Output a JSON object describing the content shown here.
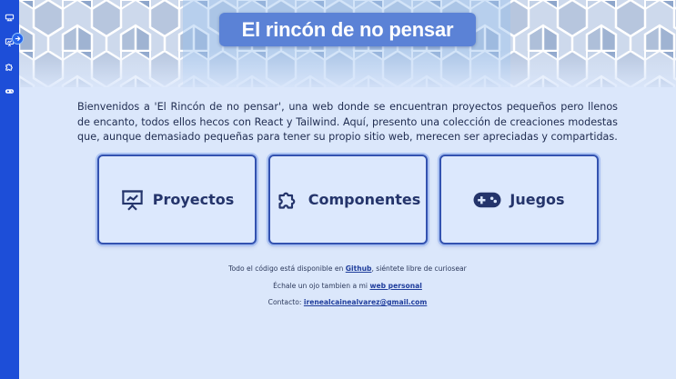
{
  "sidebar": {
    "items": [
      {
        "icon": "gamepad-retro-icon"
      },
      {
        "icon": "presentation-icon"
      },
      {
        "icon": "puzzle-icon"
      },
      {
        "icon": "gamepad-icon"
      }
    ],
    "toggle_icon": "arrow-right-icon"
  },
  "banner": {
    "title": "El rincón de no pensar"
  },
  "intro": {
    "text": "Bienvenidos a 'El Rincón de no pensar', una web donde se encuentran proyectos pequeños pero llenos de encanto, todos ellos hecos con React y Tailwind. Aquí, presento una colección de creaciones modestas que, aunque demasiado pequeñas para tener su propio sitio web, merecen ser apreciadas y compartidas."
  },
  "cards": [
    {
      "label": "Proyectos",
      "icon": "presentation-icon"
    },
    {
      "label": "Componentes",
      "icon": "puzzle-icon"
    },
    {
      "label": "Juegos",
      "icon": "gamepad-icon"
    }
  ],
  "footer": {
    "line1_prefix": "Todo el código está disponible en ",
    "line1_link": "Github",
    "line1_suffix": ", siéntete libre de curiosear",
    "line2_prefix": "Échale un ojo tambien a mi ",
    "line2_link": "web personal",
    "line2_suffix": "",
    "line3_prefix": "Contacto: ",
    "line3_link": "irenealcainealvarez@gmail.com"
  },
  "colors": {
    "sidebar": "#1d4ed8",
    "title_pill": "#5b82d6",
    "card_border": "#3352b0",
    "background": "#dbe7fb"
  }
}
